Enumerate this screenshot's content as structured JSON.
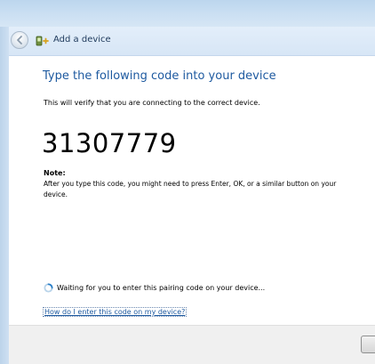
{
  "window": {
    "title": "Add a device"
  },
  "main": {
    "heading": "Type the following code into your device",
    "description": "This will verify that you are connecting to the correct device.",
    "pairing_code": "31307779",
    "note_label": "Note:",
    "note_text": "After you type this code, you might need to press Enter, OK, or a similar button on your device."
  },
  "status": {
    "text": "Waiting for you to enter this pairing code on your device..."
  },
  "help": {
    "link_text": "How do I enter this code on my device?"
  },
  "icons": {
    "back": "back-arrow-icon",
    "wizard": "add-device-icon",
    "spinner": "busy-spinner-icon"
  },
  "colors": {
    "heading": "#1e5aa0",
    "link": "#1e5aa0",
    "frame": "#c9def2"
  }
}
